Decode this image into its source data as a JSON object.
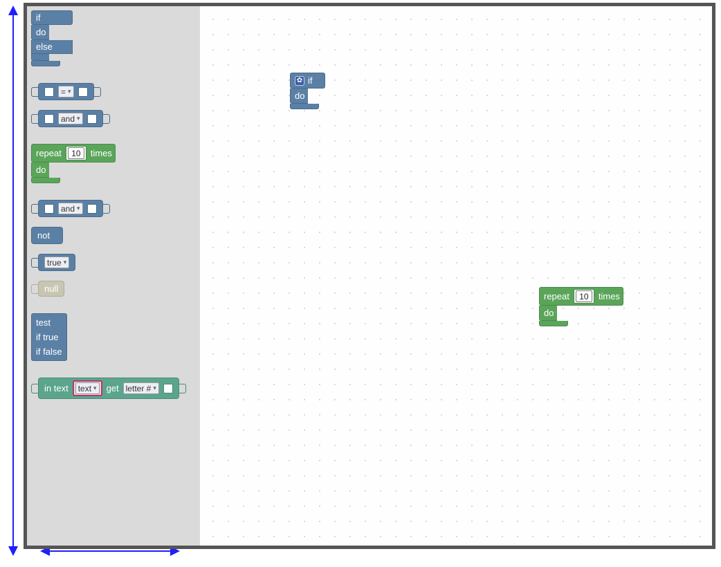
{
  "colors": {
    "logic": "#5b80a5",
    "loop": "#5ba55b",
    "text": "#5ba58c",
    "null": "#c8c6b3",
    "arrow": "#1f1fff"
  },
  "toolbox": {
    "if_do_else": {
      "if": "if",
      "do": "do",
      "else": "else"
    },
    "compare": {
      "op": "="
    },
    "logic_and_1": {
      "op": "and"
    },
    "repeat": {
      "repeat": "repeat",
      "count": "10",
      "times": "times",
      "do": "do"
    },
    "logic_and_2": {
      "op": "and"
    },
    "not": {
      "label": "not"
    },
    "bool": {
      "value": "true"
    },
    "null": {
      "label": "null"
    },
    "ternary": {
      "test": "test",
      "if_true": "if true",
      "if_false": "if false"
    },
    "in_text": {
      "in_text": "in text",
      "var": "text",
      "get": "get",
      "mode": "letter #"
    }
  },
  "workspace": {
    "if_block": {
      "if": "if",
      "do": "do"
    },
    "repeat_block": {
      "repeat": "repeat",
      "count": "10",
      "times": "times",
      "do": "do"
    }
  }
}
